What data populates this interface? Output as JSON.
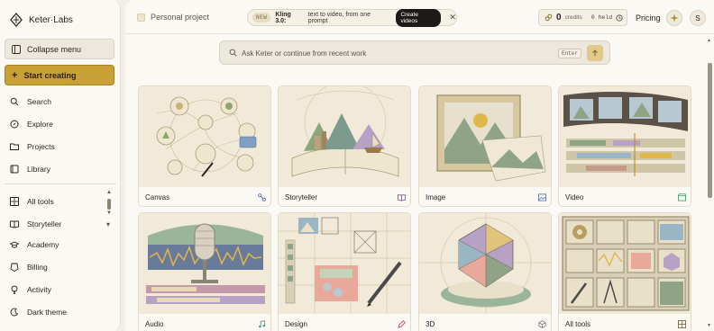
{
  "sidebar": {
    "brand": "Keter·Labs",
    "collapse_label": "Collapse menu",
    "start_label": "Start creating",
    "nav_primary": [
      {
        "label": "Search",
        "icon": "search-icon"
      },
      {
        "label": "Explore",
        "icon": "compass-icon"
      },
      {
        "label": "Projects",
        "icon": "folder-icon"
      },
      {
        "label": "Library",
        "icon": "book-icon"
      }
    ],
    "nav_secondary": [
      {
        "label": "All tools",
        "icon": "grid-icon"
      },
      {
        "label": "Storyteller",
        "icon": "book-open-icon"
      },
      {
        "label": "Academy",
        "icon": "cap-icon"
      },
      {
        "label": "Billing",
        "icon": "ticket-icon"
      },
      {
        "label": "Activity",
        "icon": "bulb-icon"
      },
      {
        "label": "Dark theme",
        "icon": "moon-icon"
      }
    ]
  },
  "topbar": {
    "project": "Personal project",
    "promo": {
      "tag": "NEW",
      "title": "Kling 3.0:",
      "text": "text to video, from one prompt",
      "button": "Create videos"
    },
    "credits": {
      "count": "0",
      "label": "credits",
      "held": "0 held"
    },
    "pricing": "Pricing",
    "avatar": "S"
  },
  "prompt": {
    "placeholder": "Ask Keter or continue from recent work",
    "enter_hint": "Enter"
  },
  "tools": [
    {
      "label": "Canvas",
      "icon": "nodes-icon",
      "accent": "#4a5fb8"
    },
    {
      "label": "Storyteller",
      "icon": "book-icon",
      "accent": "#7a4fb8"
    },
    {
      "label": "Image",
      "icon": "image-icon",
      "accent": "#3a6fd0"
    },
    {
      "label": "Video",
      "icon": "clapper-icon",
      "accent": "#2e9a55"
    },
    {
      "label": "Audio",
      "icon": "music-icon",
      "accent": "#2e9a8a"
    },
    {
      "label": "Design",
      "icon": "pen-tool-icon",
      "accent": "#c23a6a"
    },
    {
      "label": "3D",
      "icon": "cube-icon",
      "accent": "#6a6a6a"
    },
    {
      "label": "All tools",
      "icon": "grid-icon",
      "accent": "#6a5a3a"
    }
  ]
}
